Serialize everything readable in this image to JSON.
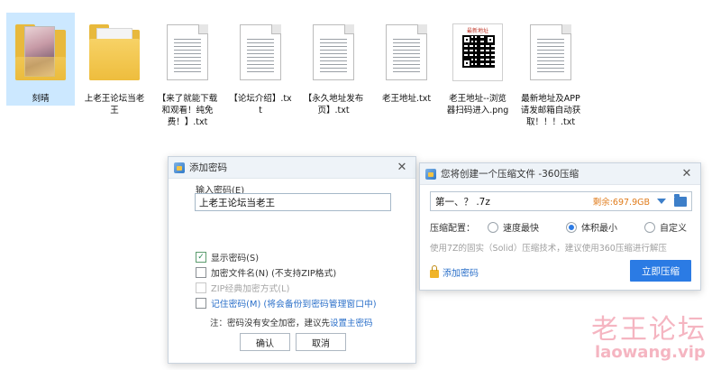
{
  "files": [
    {
      "name": "刻晴",
      "type": "folder-photo",
      "selected": true
    },
    {
      "name": "上老王论坛当老王",
      "type": "folder"
    },
    {
      "name": "【来了就能下载和观看！纯免费！】.txt",
      "type": "txt"
    },
    {
      "name": "【论坛介绍】.txt",
      "type": "txt"
    },
    {
      "name": "【永久地址发布页】.txt",
      "type": "txt"
    },
    {
      "name": "老王地址.txt",
      "type": "txt"
    },
    {
      "name": "老王地址--浏览器扫码进入.png",
      "type": "png",
      "thumb_title": "最新地址"
    },
    {
      "name": "最新地址及APP请发邮箱自动获取！！！.txt",
      "type": "txt"
    }
  ],
  "password_dialog": {
    "title": "添加密码",
    "input_label": "输入密码(E)",
    "password_value": "上老王论坛当老王",
    "options": [
      {
        "label": "显示密码(S)",
        "checked": true,
        "enabled": true
      },
      {
        "label": "加密文件名(N) (不支持ZIP格式)",
        "checked": false,
        "enabled": true
      },
      {
        "label": "ZIP经典加密方式(L)",
        "checked": false,
        "enabled": false
      },
      {
        "label": "记住密码(M) (将会备份到密码管理窗口中)",
        "checked": false,
        "enabled": true,
        "link_style": true
      }
    ],
    "note_prefix": "注：密码没有安全加密，建议先",
    "note_link": "设置主密码",
    "ok_label": "确认",
    "cancel_label": "取消"
  },
  "compress_dialog": {
    "title": "您将创建一个压缩文件 -360压缩",
    "file_name": "第一、？ .7z",
    "free_space": "剩余:697.9GB",
    "config_label": "压缩配置：",
    "modes": [
      {
        "label": "速度最快",
        "selected": false
      },
      {
        "label": "体积最小",
        "selected": true
      },
      {
        "label": "自定义",
        "selected": false
      }
    ],
    "hint": "使用7Z的固实（Solid）压缩技术，建议使用360压缩进行解压",
    "add_password_label": "添加密码",
    "compress_button": "立即压缩"
  },
  "watermark": {
    "title": "老王论坛",
    "domain": "laowang.vip"
  },
  "colors": {
    "accent_blue": "#2b7be4",
    "free_space_orange": "#e07b1a",
    "watermark_pink": "#e8506e"
  }
}
